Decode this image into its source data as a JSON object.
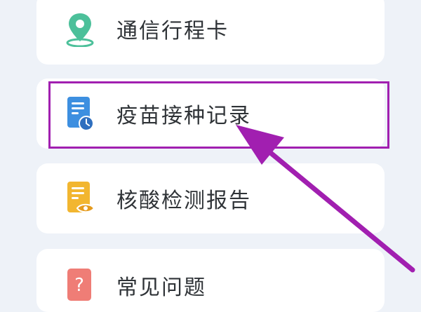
{
  "menu": {
    "items": [
      {
        "label": "通信行程卡",
        "icon": "location-pin-icon"
      },
      {
        "label": "疫苗接种记录",
        "icon": "vaccine-record-icon"
      },
      {
        "label": "核酸检测报告",
        "icon": "test-report-icon"
      },
      {
        "label": "常见问题",
        "icon": "question-icon"
      }
    ]
  },
  "colors": {
    "background": "#eef2f8",
    "highlight": "#a11fb0",
    "location_icon": "#4cc09a",
    "vaccine_icon": "#3d8fe0",
    "report_icon": "#f2b630",
    "question_icon": "#ef7d76"
  }
}
